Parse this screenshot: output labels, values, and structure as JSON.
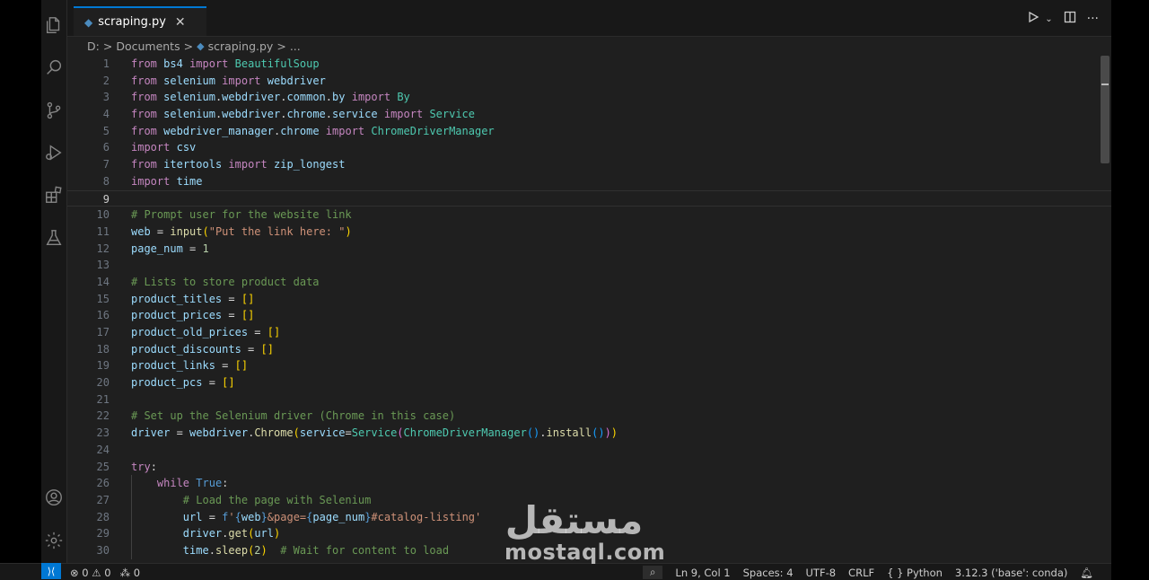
{
  "tab": {
    "filename": "scraping.py",
    "close": "✕",
    "file_icon": "python-icon"
  },
  "breadcrumb": {
    "drive": "D:",
    "sep": ">",
    "folder": "Documents",
    "file": "scraping.py",
    "tail": "..."
  },
  "code_lines": [
    {
      "n": "1",
      "t": "from bs4 import BeautifulSoup"
    },
    {
      "n": "2",
      "t": "from selenium import webdriver"
    },
    {
      "n": "3",
      "t": "from selenium.webdriver.common.by import By"
    },
    {
      "n": "4",
      "t": "from selenium.webdriver.chrome.service import Service"
    },
    {
      "n": "5",
      "t": "from webdriver_manager.chrome import ChromeDriverManager"
    },
    {
      "n": "6",
      "t": "import csv"
    },
    {
      "n": "7",
      "t": "from itertools import zip_longest"
    },
    {
      "n": "8",
      "t": "import time"
    },
    {
      "n": "9",
      "t": ""
    },
    {
      "n": "10",
      "t": "# Prompt user for the website link"
    },
    {
      "n": "11",
      "t": "web = input(\"Put the link here: \")"
    },
    {
      "n": "12",
      "t": "page_num = 1"
    },
    {
      "n": "13",
      "t": ""
    },
    {
      "n": "14",
      "t": "# Lists to store product data"
    },
    {
      "n": "15",
      "t": "product_titles = []"
    },
    {
      "n": "16",
      "t": "product_prices = []"
    },
    {
      "n": "17",
      "t": "product_old_prices = []"
    },
    {
      "n": "18",
      "t": "product_discounts = []"
    },
    {
      "n": "19",
      "t": "product_links = []"
    },
    {
      "n": "20",
      "t": "product_pcs = []"
    },
    {
      "n": "21",
      "t": ""
    },
    {
      "n": "22",
      "t": "# Set up the Selenium driver (Chrome in this case)"
    },
    {
      "n": "23",
      "t": "driver = webdriver.Chrome(service=Service(ChromeDriverManager().install()))"
    },
    {
      "n": "24",
      "t": ""
    },
    {
      "n": "25",
      "t": "try:"
    },
    {
      "n": "26",
      "t": "    while True:"
    },
    {
      "n": "27",
      "t": "        # Load the page with Selenium"
    },
    {
      "n": "28",
      "t": "        url = f'{web}&page={page_num}#catalog-listing'"
    },
    {
      "n": "29",
      "t": "        driver.get(url)"
    },
    {
      "n": "30",
      "t": "        time.sleep(2)  # Wait for content to load"
    }
  ],
  "current_line": "9",
  "status": {
    "errors": "0",
    "warnings": "0",
    "ports": "0",
    "position": "Ln 9, Col 1",
    "spaces": "Spaces: 4",
    "encoding": "UTF-8",
    "eol": "CRLF",
    "language": "Python",
    "language_icon": "{ }",
    "interpreter": "3.12.3 ('base': conda)"
  },
  "watermark": {
    "arabic": "مستقل",
    "latin": "mostaql.com"
  },
  "colors": {
    "accent": "#0078d4",
    "editor_bg": "#1f1f1f",
    "keyword": "#c586c0",
    "string": "#ce9178",
    "comment": "#6a9955"
  }
}
